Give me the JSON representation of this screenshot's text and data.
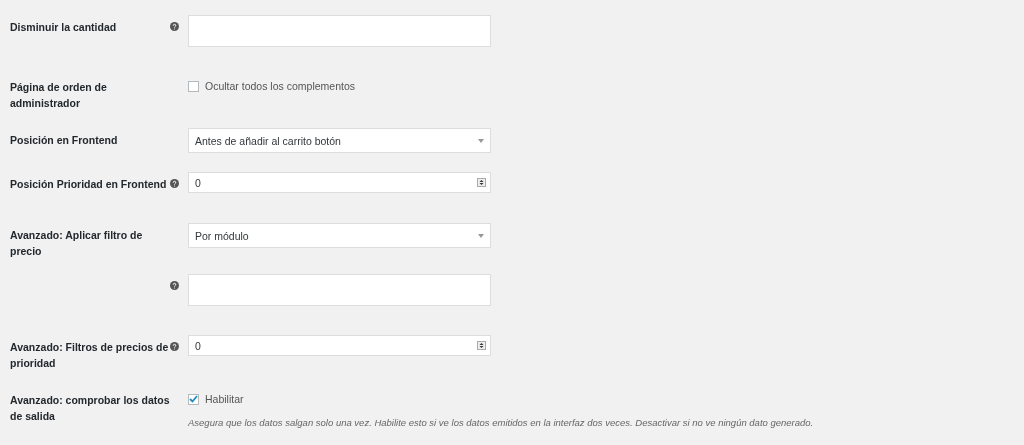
{
  "rows": [
    {
      "label": "Disminuir la cantidad",
      "help": true,
      "kind": "textarea",
      "value": ""
    },
    {
      "label": "Página de orden de administrador",
      "help": false,
      "kind": "checkbox",
      "option": "Ocultar todos los complementos",
      "checked": false
    },
    {
      "label": "Posición en Frontend",
      "help": false,
      "kind": "select",
      "value": "Antes de añadir al carrito botón"
    },
    {
      "label": "Posición Prioridad en Frontend",
      "help": true,
      "kind": "number",
      "value": "0"
    },
    {
      "label": "Avanzado: Aplicar filtro de precio",
      "help": false,
      "kind": "select",
      "value": "Por módulo"
    },
    {
      "help": true,
      "kind": "textarea",
      "value": ""
    },
    {
      "label": "Avanzado: Filtros de precios de prioridad",
      "help": true,
      "kind": "number",
      "value": "0"
    },
    {
      "label": "Avanzado: comprobar los datos de salida",
      "help": false,
      "kind": "checkbox",
      "option": "Habilitar",
      "checked": true,
      "description": "Asegura que los datos salgan solo una vez. Habilite esto si ve los datos emitidos en la interfaz dos veces. Desactivar si no ve ningún dato generado."
    }
  ]
}
